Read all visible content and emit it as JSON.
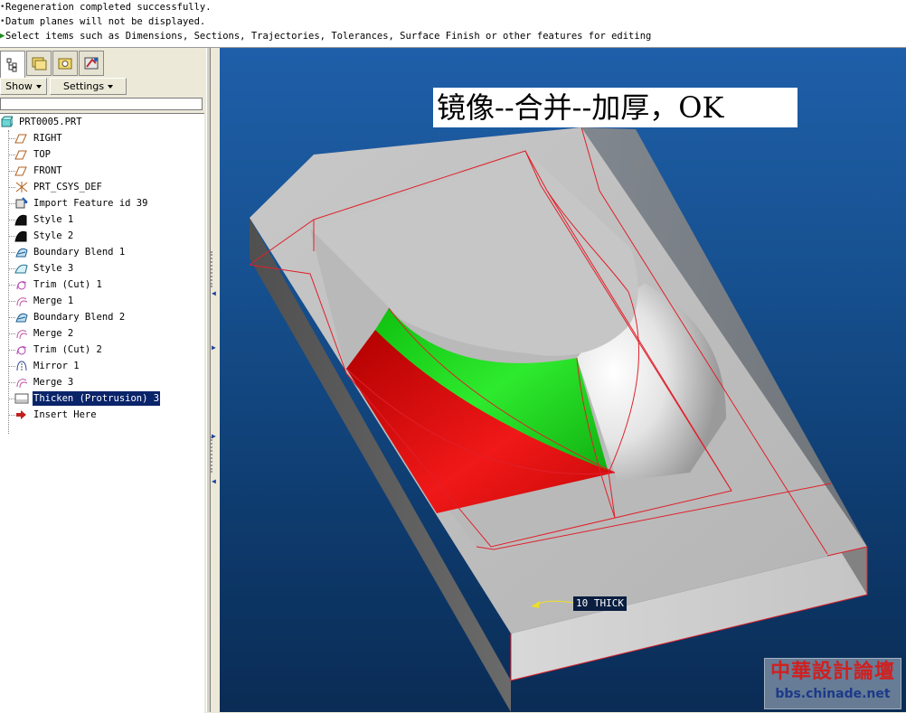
{
  "messages": [
    {
      "text": "Regeneration completed successfully.",
      "marker": "•"
    },
    {
      "text": "Datum planes will not be displayed.",
      "marker": "•"
    },
    {
      "text": "Select items such as Dimensions, Sections, Trajectories, Tolerances, Surface Finish or other features for editing",
      "marker": "▶"
    }
  ],
  "navigator": {
    "tabs": [
      {
        "name": "model-tree-tab-icon"
      },
      {
        "name": "folder-browser-tab-icon"
      },
      {
        "name": "favorites-tab-icon"
      },
      {
        "name": "connections-tab-icon"
      }
    ],
    "show_label": "Show",
    "settings_label": "Settings"
  },
  "model_tree": {
    "root": "PRT0005.PRT",
    "items": [
      {
        "label": "RIGHT",
        "icon": "datum-plane-icon"
      },
      {
        "label": "TOP",
        "icon": "datum-plane-icon"
      },
      {
        "label": "FRONT",
        "icon": "datum-plane-icon"
      },
      {
        "label": "PRT_CSYS_DEF",
        "icon": "csys-icon"
      },
      {
        "label": "Import Feature id 39",
        "icon": "import-feature-icon"
      },
      {
        "label": "Style 1",
        "icon": "style-icon"
      },
      {
        "label": "Style 2",
        "icon": "style-icon"
      },
      {
        "label": "Boundary Blend 1",
        "icon": "boundary-blend-icon"
      },
      {
        "label": "Style 3",
        "icon": "style-surface-icon"
      },
      {
        "label": "Trim (Cut) 1",
        "icon": "trim-icon"
      },
      {
        "label": "Merge 1",
        "icon": "merge-icon"
      },
      {
        "label": "Boundary Blend 2",
        "icon": "boundary-blend-icon"
      },
      {
        "label": "Merge 2",
        "icon": "merge-icon"
      },
      {
        "label": "Trim (Cut) 2",
        "icon": "trim-icon"
      },
      {
        "label": "Mirror 1",
        "icon": "mirror-icon"
      },
      {
        "label": "Merge 3",
        "icon": "merge-icon"
      },
      {
        "label": "Thicken (Protrusion) 3",
        "icon": "thicken-icon",
        "selected": true
      },
      {
        "label": "Insert Here",
        "icon": "insert-here-arrow-icon"
      }
    ]
  },
  "viewport": {
    "annotation": "镜像--合并--加厚，OK",
    "dimension_label": "10 THICK",
    "watermark_title": "中華設計論壇",
    "watermark_url": "bbs.chinade.net"
  },
  "colors": {
    "selection": "#0a246a",
    "edge_highlight": "#e0202a",
    "surface_green": "#1bd61b",
    "surface_red": "#e01010",
    "background_top": "#1f5fa9",
    "background_bottom": "#0a2c55"
  }
}
